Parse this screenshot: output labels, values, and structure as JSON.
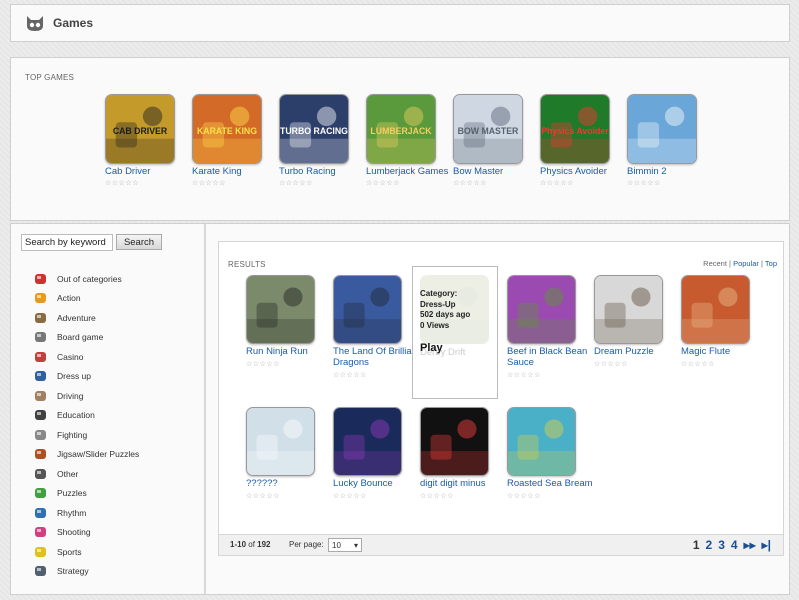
{
  "header": {
    "title": "Games"
  },
  "top_games": {
    "label": "TOP GAMES",
    "items": [
      {
        "name": "Cab Driver",
        "thumb_text": "CAB DRIVER",
        "bg": "#c49a2a",
        "fg": "#1c1c1c"
      },
      {
        "name": "Karate King",
        "thumb_text": "KARATE KING",
        "bg": "#d46a28",
        "fg": "#ffe04a"
      },
      {
        "name": "Turbo Racing",
        "thumb_text": "TURBO RACING",
        "bg": "#2c3e6a",
        "fg": "#ffffff"
      },
      {
        "name": "Lumberjack Games",
        "thumb_text": "LUMBERJACK",
        "bg": "#5a9a3c",
        "fg": "#f0d060"
      },
      {
        "name": "Bow Master",
        "thumb_text": "BOW MASTER",
        "bg": "#cfd8e2",
        "fg": "#556070"
      },
      {
        "name": "Physics Avoider",
        "thumb_text": "Physics Avoider",
        "bg": "#1f7a2a",
        "fg": "#ff3030"
      },
      {
        "name": "Bimmin 2",
        "thumb_text": "",
        "bg": "#6aa6d8",
        "fg": "#ffffff"
      }
    ],
    "stars": "☆☆☆☆☆"
  },
  "search": {
    "placeholder": "Search by keyword",
    "button": "Search"
  },
  "categories": [
    {
      "label": "Out of categories",
      "color": "#d03030"
    },
    {
      "label": "Action",
      "color": "#e89a20"
    },
    {
      "label": "Adventure",
      "color": "#8a6a40"
    },
    {
      "label": "Board game",
      "color": "#777777"
    },
    {
      "label": "Casino",
      "color": "#c04040"
    },
    {
      "label": "Dress up",
      "color": "#3060a0"
    },
    {
      "label": "Driving",
      "color": "#a08060"
    },
    {
      "label": "Education",
      "color": "#404040"
    },
    {
      "label": "Fighting",
      "color": "#888888"
    },
    {
      "label": "Jigsaw/Slider Puzzles",
      "color": "#b05020"
    },
    {
      "label": "Other",
      "color": "#555555"
    },
    {
      "label": "Puzzles",
      "color": "#40a040"
    },
    {
      "label": "Rhythm",
      "color": "#3070b0"
    },
    {
      "label": "Shooting",
      "color": "#d04080"
    },
    {
      "label": "Sports",
      "color": "#e0c020"
    },
    {
      "label": "Strategy",
      "color": "#506070"
    }
  ],
  "results": {
    "label": "RESULTS",
    "sort": {
      "recent": "Recent",
      "popular": "Popular",
      "top": "Top"
    },
    "rows": [
      [
        {
          "name": "Run Ninja Run",
          "bg": "#7a8a6a",
          "fg": "#202020"
        },
        {
          "name": "The Land Of Brilliant Dragons",
          "bg": "#3a5aa0",
          "fg": "#202830"
        },
        {
          "name": "Derby Drift",
          "bg": "#8a9a5a",
          "fg": "#406030",
          "hover": true
        },
        {
          "name": "Beef in Black Bean Sauce",
          "bg": "#9a4ab0",
          "fg": "#5a9a30"
        },
        {
          "name": "Dream Puzzle",
          "bg": "#d8d8d8",
          "fg": "#5a4a3a"
        },
        {
          "name": "Magic Flute",
          "bg": "#c85a30",
          "fg": "#e8c090"
        }
      ],
      [
        {
          "name": "??????",
          "bg": "#d0dfe8",
          "fg": "#ffffff"
        },
        {
          "name": "Lucky Bounce",
          "bg": "#1a2a5a",
          "fg": "#9a3ac0"
        },
        {
          "name": "digit digit minus",
          "bg": "#111111",
          "fg": "#ff4040"
        },
        {
          "name": "Roasted Sea Bream",
          "bg": "#4ab0c8",
          "fg": "#e0d040"
        }
      ]
    ],
    "hover_card": {
      "category_label": "Category:",
      "category": "Dress-Up",
      "age": "502 days ago",
      "views": "0 Views",
      "play": "Play"
    },
    "stars": "☆☆☆☆☆"
  },
  "pager": {
    "range": "1-10",
    "of_label": "of",
    "total": "192",
    "per_page_label": "Per page:",
    "per_page": "10",
    "pages": [
      "1",
      "2",
      "3",
      "4"
    ],
    "next_icon": "next-icon",
    "last_icon": "last-icon"
  }
}
